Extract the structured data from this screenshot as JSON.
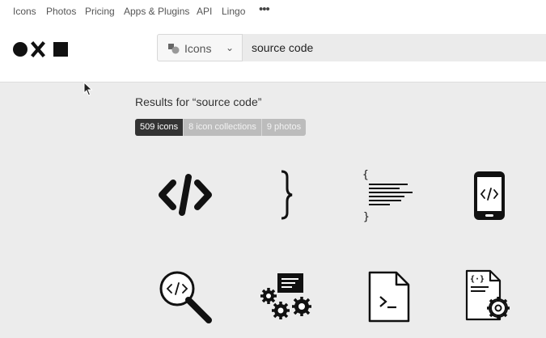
{
  "nav": {
    "items": [
      {
        "label": "Icons"
      },
      {
        "label": "Photos"
      },
      {
        "label": "Pricing"
      },
      {
        "label": "Apps & Plugins"
      },
      {
        "label": "API"
      },
      {
        "label": "Lingo"
      }
    ],
    "more_icon": "ellipsis-icon",
    "more_label": "•••"
  },
  "header": {
    "logo_icon": "noun-project-logo",
    "search": {
      "type_label": "Icons",
      "type_icon": "icons-type-icon",
      "chevron_icon": "chevron-down-icon",
      "value": "source code"
    }
  },
  "results": {
    "title": "Results for “source code”",
    "tabs": [
      {
        "label": "509 icons",
        "active": true
      },
      {
        "label": "8 icon collections",
        "active": false
      },
      {
        "label": "9 photos",
        "active": false
      }
    ]
  },
  "icons": [
    {
      "name": "code-tags-icon"
    },
    {
      "name": "curly-bracket-icon"
    },
    {
      "name": "code-document-lines-icon"
    },
    {
      "name": "mobile-code-icon"
    },
    {
      "name": "magnifier-code-icon"
    },
    {
      "name": "gears-code-icon"
    },
    {
      "name": "terminal-file-icon"
    },
    {
      "name": "code-file-gear-icon"
    }
  ],
  "colors": {
    "background": "#ececec",
    "header": "#ffffff",
    "active_tab": "#333333",
    "inactive_tab": "#bcbcbc"
  }
}
